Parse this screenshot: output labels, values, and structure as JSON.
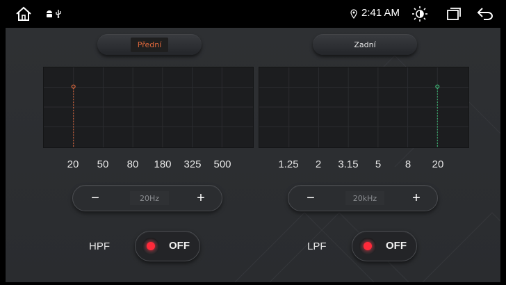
{
  "status_bar": {
    "time": "2:41 AM",
    "icons": [
      "home-icon",
      "android-icon",
      "usb-icon",
      "location-icon",
      "brightness-icon",
      "window-icon",
      "back-icon"
    ]
  },
  "tabs": [
    {
      "label": "Přední",
      "selected": true
    },
    {
      "label": "Zadní",
      "selected": false
    }
  ],
  "front": {
    "freq_labels": [
      "20",
      "50",
      "80",
      "180",
      "325",
      "500"
    ],
    "selected_freq_index": 0,
    "marker_color": "#e0683c",
    "stepper": {
      "minus": "−",
      "value": "20Hz",
      "plus": "+"
    },
    "filter": {
      "label": "HPF",
      "state": "OFF"
    }
  },
  "rear": {
    "freq_labels": [
      "1.25",
      "2",
      "3.15",
      "5",
      "8",
      "20"
    ],
    "selected_freq_index": 5,
    "marker_color": "#3ec07a",
    "stepper": {
      "minus": "−",
      "value": "20kHz",
      "plus": "+"
    },
    "filter": {
      "label": "LPF",
      "state": "OFF"
    }
  },
  "colors": {
    "accent_front": "#e0683c",
    "accent_rear": "#3ec07a",
    "toggle_indicator": "#ff2a3a"
  }
}
